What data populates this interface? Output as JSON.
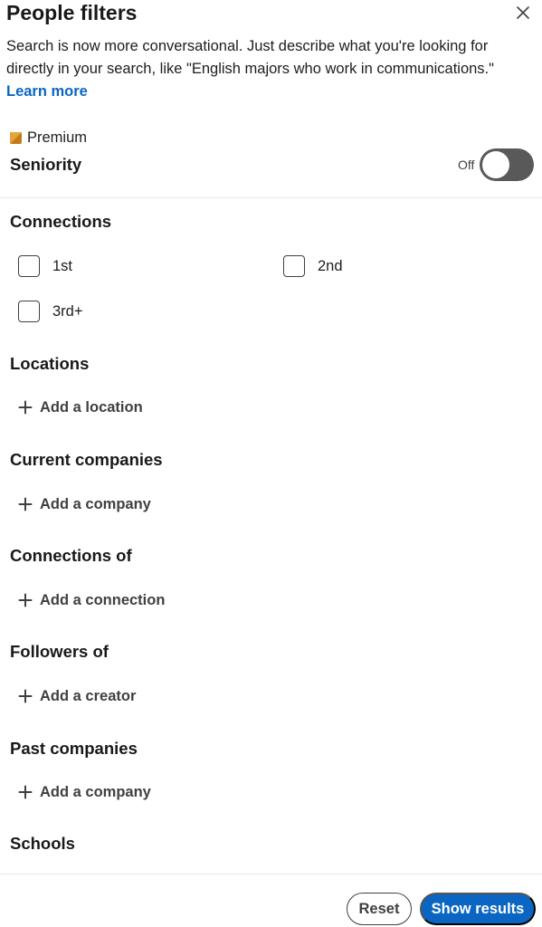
{
  "header": {
    "title": "People filters"
  },
  "description": {
    "text": "Search is now more conversational. Just describe what you're looking for directly in your search, like \"English majors who work in communications.\"",
    "link_label": "Learn more"
  },
  "premium": {
    "label": "Premium",
    "icon_color": "#c37d16"
  },
  "seniority": {
    "label": "Seniority",
    "toggle_state": "Off",
    "toggle_on": false
  },
  "connections": {
    "title": "Connections",
    "options": [
      {
        "label": "1st",
        "checked": false
      },
      {
        "label": "2nd",
        "checked": false
      },
      {
        "label": "3rd+",
        "checked": false
      }
    ]
  },
  "sections": [
    {
      "title": "Locations",
      "add_label": "Add a location"
    },
    {
      "title": "Current companies",
      "add_label": "Add a company"
    },
    {
      "title": "Connections of",
      "add_label": "Add a connection"
    },
    {
      "title": "Followers of",
      "add_label": "Add a creator"
    },
    {
      "title": "Past companies",
      "add_label": "Add a company"
    },
    {
      "title": "Schools"
    }
  ],
  "footer": {
    "reset_label": "Reset",
    "show_results_label": "Show results"
  },
  "colors": {
    "accent": "#0a66c2",
    "text": "#191919",
    "toggle_off": "#595959"
  }
}
